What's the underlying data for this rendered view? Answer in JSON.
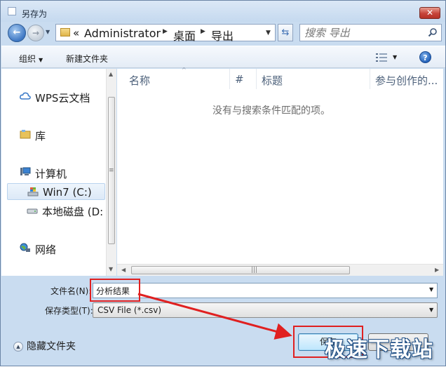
{
  "window": {
    "title": "另存为",
    "close_label": "✕"
  },
  "nav": {
    "back_icon": "back-arrow-icon",
    "forward_icon": "forward-arrow-icon",
    "address": {
      "overflow": "«",
      "segments": [
        "Administrator",
        "桌面",
        "导出"
      ]
    },
    "search_placeholder": "搜索 导出"
  },
  "commandbar": {
    "organize_label": "组织",
    "new_folder_label": "新建文件夹",
    "help_label": "?"
  },
  "sidebar": {
    "items": [
      {
        "label": "WPS云文档",
        "icon": "cloud-icon"
      },
      {
        "label": "库",
        "icon": "library-icon"
      },
      {
        "label": "计算机",
        "icon": "computer-icon"
      },
      {
        "label": "Win7 (C:)",
        "icon": "system-drive-icon",
        "selected": true
      },
      {
        "label": "本地磁盘 (D:",
        "icon": "drive-icon"
      },
      {
        "label": "网络",
        "icon": "network-icon"
      }
    ]
  },
  "columns": [
    "名称",
    "#",
    "标题",
    "参与创作的..."
  ],
  "empty_message": "没有与搜索条件匹配的项。",
  "fields": {
    "filename_label": "文件名(N):",
    "filename_value": "分析结果",
    "filetype_label": "保存类型(T):",
    "filetype_value": "CSV File (*.csv)"
  },
  "footer": {
    "hide_folders_label": "隐藏文件夹",
    "save_label": "保存",
    "cancel_label": ""
  },
  "watermark": "极速下载站",
  "colors": {
    "accent": "#3c7fb1",
    "highlight": "#e02020",
    "frame": "#c9dcf0"
  }
}
